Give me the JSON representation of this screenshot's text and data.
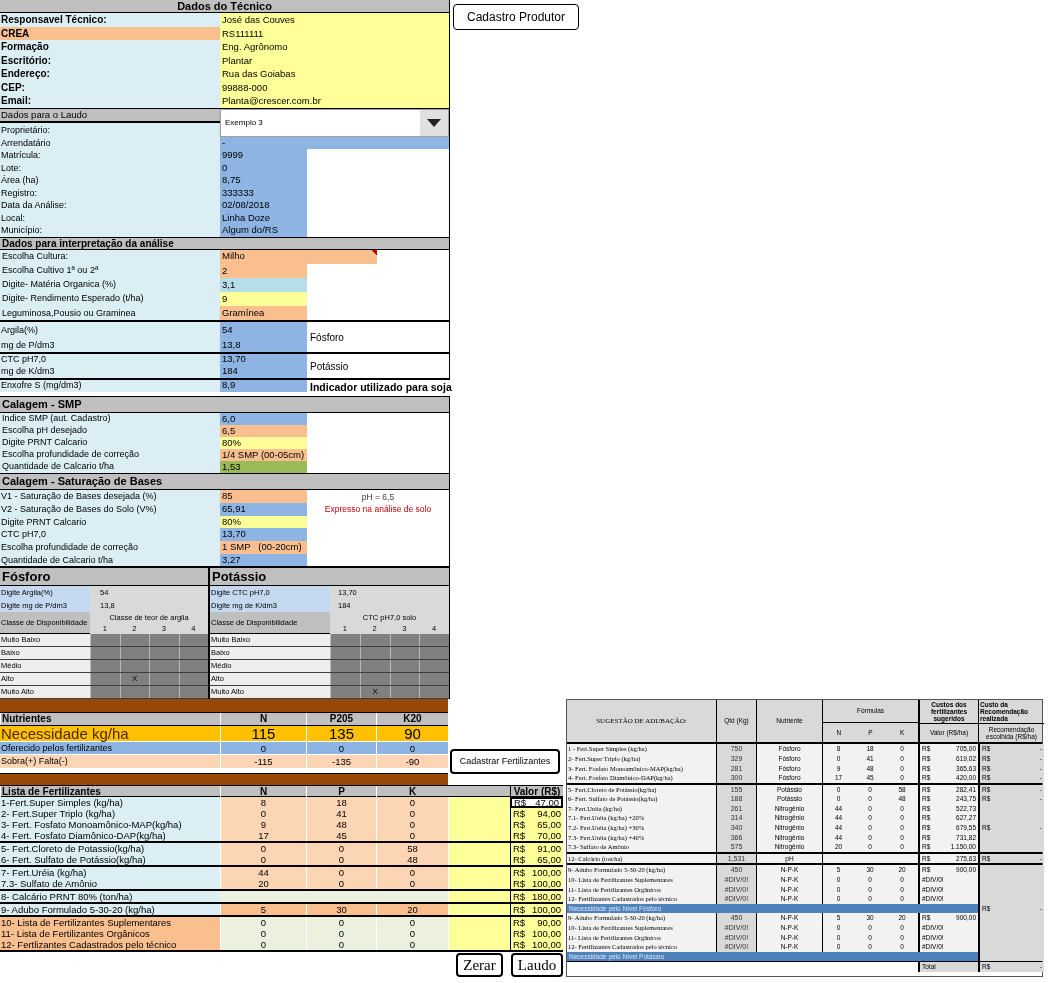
{
  "top_button": "Cadastro Produtor",
  "technician": {
    "title": "Dados do Técnico",
    "rows": [
      {
        "label": "Responsavel Técnico:",
        "value": "José das Couves",
        "highlight": false
      },
      {
        "label": "CREA",
        "value": "RS111111",
        "highlight": true
      },
      {
        "label": "Formação",
        "value": "Eng. Agrônomo",
        "highlight": false
      },
      {
        "label": "Escritório:",
        "value": "Plantar",
        "highlight": false
      },
      {
        "label": "Endereço:",
        "value": "Rua das Goiabas",
        "highlight": false
      },
      {
        "label": "CEP:",
        "value": "99888-000",
        "highlight": false
      },
      {
        "label": "Email:",
        "value": "Planta@crescer.com.br",
        "highlight": false
      }
    ]
  },
  "laudo": {
    "title": "Dados para o Laudo",
    "owner_label": "Proprietário:",
    "dropdown": {
      "value": "Exemplo 3"
    },
    "rows": [
      {
        "label": "Arrendatário",
        "value": "-",
        "wide": true
      },
      {
        "label": "Matrícula:",
        "value": "9999",
        "wide": false
      },
      {
        "label": "Lote:",
        "value": "0",
        "wide": false
      },
      {
        "label": "Área (ha)",
        "value": "8,75",
        "wide": false
      },
      {
        "label": "Registro:",
        "value": "333333",
        "wide": false
      },
      {
        "label": "Data da Análise:",
        "value": "02/08/2018",
        "wide": false
      },
      {
        "label": "Local:",
        "value": "Linha Doze",
        "wide": false
      },
      {
        "label": "Município:",
        "value": "Algum do/RS",
        "wide": false
      }
    ]
  },
  "interpretation": {
    "title": "Dados para interpretação da análise",
    "rows": [
      {
        "label": "Escolha Cultura:",
        "value": "Milho",
        "color": "#fabf8f",
        "wide": true,
        "comment": true
      },
      {
        "label": "Escolha Cultivo 1ª ou 2ª",
        "value": "2",
        "color": "#fabf8f",
        "wide": false,
        "comment": false
      },
      {
        "label": "Digite- Matéria Organica (%)",
        "value": "3,1",
        "color": "#b7dee8",
        "wide": false,
        "comment": false
      },
      {
        "label": "Digite- Rendimento Esperado (t/ha)",
        "value": "9",
        "color": "#ffff99",
        "wide": false,
        "comment": false
      },
      {
        "label": "Leguminosa,Pousio ou Graminea",
        "value": "Gramínea",
        "color": "#fabf8f",
        "wide": false,
        "comment": false
      }
    ],
    "blocks": [
      {
        "side": "Fósforo",
        "bold": false,
        "rows": [
          {
            "label": "Argila(%)",
            "value": "54",
            "color": "#8db4e2"
          },
          {
            "label": "mg de P/dm3",
            "value": "13,8",
            "color": "#8db4e2"
          }
        ]
      },
      {
        "side": "Potássio",
        "bold": false,
        "rows": [
          {
            "label": "CTC pH7,0",
            "value": "13,70",
            "color": "#8db4e2"
          },
          {
            "label": "mg de K/dm3",
            "value": "184",
            "color": "#8db4e2"
          }
        ]
      },
      {
        "side": "Indicador utilizado para soja",
        "bold": true,
        "rows": [
          {
            "label": "Enxofre S (mg/dm3)",
            "value": "8,9",
            "color": "#8db4e2"
          }
        ]
      }
    ]
  },
  "calagem_smp": {
    "title": "Calagem - SMP",
    "rows": [
      {
        "label": "Indice SMP (aut. Cadastro)",
        "value": "6,0",
        "color": "#8db4e2"
      },
      {
        "label": "Escolha pH desejado",
        "value": "6,5",
        "color": "#fabf8f"
      },
      {
        "label": "Digite PRNT  Calcario",
        "value": "80%",
        "color": "#ffff99"
      },
      {
        "label": "Escolha profundidade de correção",
        "value": "1/4 SMP (00-05cm)",
        "color": "#fabf8f"
      },
      {
        "label": "Quantidade de Calcario t/ha",
        "value": "1,53",
        "color": "#9bbb59"
      }
    ]
  },
  "calagem_saturacao": {
    "title": "Calagem - Saturação de Bases",
    "rows": [
      {
        "label": "V1 - Saturação de Bases desejada (%)",
        "value": "85",
        "color": "#fabf8f",
        "note": {
          "text": "pH = 6,5",
          "kind": "remark"
        }
      },
      {
        "label": "V2 - Saturação de Bases do Solo (V%)",
        "value": "65,91",
        "color": "#8db4e2",
        "note": {
          "text": "Expresso na análise de solo",
          "kind": "warning"
        }
      },
      {
        "label": "Digite PRNT Calcario",
        "value": "80%",
        "color": "#ffff99"
      },
      {
        "label": "CTC pH7,0",
        "value": "13,70",
        "color": "#8db4e2"
      },
      {
        "label": "Escolha profundidade de correção",
        "value": "1 SMP   (00-20cm)",
        "color": "#fabf8f"
      },
      {
        "label": "Quantidade de Calcario t/ha",
        "value": "3,27",
        "color": "#8db4e2"
      }
    ]
  },
  "availability": [
    {
      "title": "Fósforo",
      "inputs": [
        {
          "label": "Digite Argila(%)",
          "value": "54"
        },
        {
          "label": "Digite mg de P/dm3",
          "value": "13,8"
        }
      ],
      "class_label": "Classe de Disponibilidade",
      "columns_title": "Classe de teor de argila",
      "columns": [
        "1",
        "2",
        "3",
        "4"
      ],
      "mark_text": "X",
      "rows": [
        {
          "label": "Muito Baixo",
          "cells": [
            {
              "marked": false
            },
            {
              "marked": false
            },
            {
              "marked": false
            },
            {
              "marked": false
            }
          ]
        },
        {
          "label": "Baixo",
          "cells": [
            {
              "marked": false
            },
            {
              "marked": false
            },
            {
              "marked": false
            },
            {
              "marked": false
            }
          ]
        },
        {
          "label": "Médio",
          "cells": [
            {
              "marked": false
            },
            {
              "marked": false
            },
            {
              "marked": false
            },
            {
              "marked": false
            }
          ]
        },
        {
          "label": "Alto",
          "cells": [
            {
              "marked": false
            },
            {
              "marked": true
            },
            {
              "marked": false
            },
            {
              "marked": false
            }
          ]
        },
        {
          "label": "Muito Alto",
          "cells": [
            {
              "marked": false
            },
            {
              "marked": false
            },
            {
              "marked": false
            },
            {
              "marked": false
            }
          ]
        }
      ]
    },
    {
      "title": "Potássio",
      "inputs": [
        {
          "label": "Digite CTC pH7,0",
          "value": "13,70"
        },
        {
          "label": "Digite mg de K/dm3",
          "value": "184"
        }
      ],
      "class_label": "Classe de Disponibilidade",
      "columns_title": "CTC pH7,0 solo",
      "columns": [
        "1",
        "2",
        "3",
        "4"
      ],
      "mark_text": "X",
      "rows": [
        {
          "label": "Muito Baixo",
          "cells": [
            {
              "marked": false
            },
            {
              "marked": false
            },
            {
              "marked": false
            },
            {
              "marked": false
            }
          ]
        },
        {
          "label": "Baixo",
          "cells": [
            {
              "marked": false
            },
            {
              "marked": false
            },
            {
              "marked": false
            },
            {
              "marked": false
            }
          ]
        },
        {
          "label": "Médio",
          "cells": [
            {
              "marked": false
            },
            {
              "marked": false
            },
            {
              "marked": false
            },
            {
              "marked": false
            }
          ]
        },
        {
          "label": "Alto",
          "cells": [
            {
              "marked": false
            },
            {
              "marked": false
            },
            {
              "marked": false
            },
            {
              "marked": false
            }
          ]
        },
        {
          "label": "Muito Alto",
          "cells": [
            {
              "marked": false
            },
            {
              "marked": true
            },
            {
              "marked": false
            },
            {
              "marked": false
            }
          ]
        }
      ]
    }
  ],
  "nutrients": {
    "columns": [
      "Nutrientes",
      "N",
      "P205",
      "K20"
    ],
    "rows": [
      {
        "kind": "need",
        "label": "Necessidade kg/ha",
        "values": [
          "115",
          "135",
          "90"
        ]
      },
      {
        "kind": "offered",
        "label": "Oferecido pelos fertilizantes",
        "values": [
          "0",
          "0",
          "0"
        ]
      },
      {
        "kind": "balance",
        "label": "Sobra(+) Falta(-)",
        "values": [
          "-115",
          "-135",
          "-90"
        ]
      }
    ]
  },
  "register_button": "Cadastrar Fertilizantes",
  "fertilizers": {
    "columns": [
      "Lista de Fertilizantes",
      "N",
      "P",
      "K",
      "Valor (R$)"
    ],
    "groups": [
      {
        "kind": "mineral",
        "rows": [
          {
            "name": "1-Fert.Super Simples (kg/ha)",
            "values": [
              "8",
              "18",
              "0"
            ],
            "currency": "R$",
            "price": "47,00",
            "selected": true
          },
          {
            "name": "2- Fert.Super Triplo (kg/ha)",
            "values": [
              "0",
              "41",
              "0"
            ],
            "currency": "R$",
            "price": "94,00",
            "selected": false
          },
          {
            "name": "3- Fert. Fosfato Monoamônico-MAP(kg/ha)",
            "values": [
              "9",
              "48",
              "0"
            ],
            "currency": "R$",
            "price": "65,00",
            "selected": false
          },
          {
            "name": "4- Fert. Fosfato Diamônico-DAP(kg/ha)",
            "values": [
              "17",
              "45",
              "0"
            ],
            "currency": "R$",
            "price": "70,00",
            "selected": false
          }
        ]
      },
      {
        "kind": "mineral",
        "rows": [
          {
            "name": "5- Fert.Cloreto de Potassio(kg/ha)",
            "values": [
              "0",
              "0",
              "58"
            ],
            "currency": "R$",
            "price": "91,00",
            "selected": false
          },
          {
            "name": "6- Fert. Sulfato de Potássio(kg/ha)",
            "values": [
              "0",
              "0",
              "48"
            ],
            "currency": "R$",
            "price": "65,00",
            "selected": false
          }
        ]
      },
      {
        "kind": "mineral",
        "rows": [
          {
            "name": "7- Fert.Uréia (kg/ha)",
            "values": [
              "44",
              "0",
              "0"
            ],
            "currency": "R$",
            "price": "100,00",
            "selected": false
          },
          {
            "name": "7.3- Sulfato de Amônio",
            "values": [
              "20",
              "0",
              "0"
            ],
            "currency": "R$",
            "price": "100,00",
            "selected": false
          }
        ]
      },
      {
        "kind": "lime",
        "rows": [
          {
            "name": "8- Calcário PRNT 80% (ton/ha)",
            "currency": "R$",
            "price": "180,00",
            "selected": false
          }
        ]
      },
      {
        "kind": "formula",
        "rows": [
          {
            "name": "9- Adubo Formulado  5-30-20 (kg/ha)",
            "values": [
              "5",
              "30",
              "20"
            ],
            "currency": "R$",
            "price": "100,00",
            "selected": false
          }
        ]
      },
      {
        "kind": "extra",
        "rows": [
          {
            "name": "10- Lista de Fertilizantes Suplementares",
            "values": [
              "0",
              "0",
              "0"
            ],
            "currency": "R$",
            "price": "90,00",
            "selected": false
          },
          {
            "name": "11- Lista de Fertilizantes Orgânicos",
            "values": [
              "0",
              "0",
              "0"
            ],
            "currency": "R$",
            "price": "100,00",
            "selected": false
          },
          {
            "name": "12- Fertlizantes Cadastrados pelo técnico",
            "values": [
              "0",
              "0",
              "0"
            ],
            "currency": "R$",
            "price": "100,00",
            "selected": false
          }
        ]
      }
    ]
  },
  "action_buttons": [
    "Zerar",
    "Laudo"
  ],
  "suggestion": {
    "columns": {
      "name": "SUGESTÃO DE ADUBAÇÃO:",
      "qty": "Qtd (Kg)",
      "nutrient": "Nutriente",
      "formulas": "Fórmulas",
      "n": "N",
      "p": "P",
      "k": "K",
      "costs": "Custos dos fertilizantes sugeridos",
      "costs_sub": "Valor (R$/ha)",
      "rec": "Custo da Recomendação realizada",
      "rec_sub": "Recomendação escolhida (R$/ha)"
    },
    "groups": [
      {
        "rows": [
          {
            "kind": "item",
            "name": "1 - Fert.Super Simples (kg/ha)",
            "qty": "750",
            "nutrient": "Fósforo",
            "n": "8",
            "p": "18",
            "k": "0",
            "currency": "R$",
            "cost": "705,00",
            "rec_currency": "R$",
            "rec": "-"
          },
          {
            "kind": "item",
            "name": "2- Fert.Super Triplo (kg/ha)",
            "qty": "329",
            "nutrient": "Fósforo",
            "n": "0",
            "p": "41",
            "k": "0",
            "currency": "R$",
            "cost": "619,02",
            "rec_currency": "R$",
            "rec": "-"
          },
          {
            "kind": "item",
            "name": "3- Fert. Fosfato Monoamônico-MAP(kg/ha)",
            "qty": "281",
            "nutrient": "Fósforo",
            "n": "9",
            "p": "48",
            "k": "0",
            "currency": "R$",
            "cost": "365,63",
            "rec_currency": "R$",
            "rec": "-"
          },
          {
            "kind": "item",
            "name": "4- Fert. Fosfato Diamônico-DAP(kg/ha)",
            "qty": "300",
            "nutrient": "Fósforo",
            "n": "17",
            "p": "45",
            "k": "0",
            "currency": "R$",
            "cost": "420,00",
            "rec_currency": "R$",
            "rec": "-"
          }
        ]
      },
      {
        "rows": [
          {
            "kind": "item",
            "name": "5- Fert.Cloreto de Potássio(kg/ha)",
            "qty": "155",
            "nutrient": "Potássio",
            "n": "0",
            "p": "0",
            "k": "58",
            "currency": "R$",
            "cost": "282,41",
            "rec_currency": "R$",
            "rec": "-"
          },
          {
            "kind": "item",
            "name": "6- Fert. Sulfato de Potássio(kg/ha)",
            "qty": "188",
            "nutrient": "Potássio",
            "n": "0",
            "p": "0",
            "k": "48",
            "currency": "R$",
            "cost": "243,75",
            "rec_currency": "R$",
            "rec": "-"
          },
          {
            "kind": "item",
            "name": "7- Fert.Uréia (kg/ha)",
            "qty": "261",
            "nutrient": "Nitrogênio",
            "n": "44",
            "p": "0",
            "k": "0",
            "currency": "R$",
            "cost": "522,73"
          },
          {
            "kind": "item",
            "name": "7.1- Fert.Uréia (kg/ha) +20%",
            "qty": "314",
            "nutrient": "Nitrogênio",
            "n": "44",
            "p": "0",
            "k": "0",
            "currency": "R$",
            "cost": "627,27"
          },
          {
            "kind": "item",
            "name": "7.2- Fert.Uréia (kg/ha) +30%",
            "qty": "340",
            "nutrient": "Nitrogênio",
            "n": "44",
            "p": "0",
            "k": "0",
            "currency": "R$",
            "cost": "679,55",
            "rec_currency": "R$",
            "rec": "-"
          },
          {
            "kind": "item",
            "name": "7.3- Fert.Uréia (kg/ha) +40%",
            "qty": "366",
            "nutrient": "Nitrogênio",
            "n": "44",
            "p": "0",
            "k": "0",
            "currency": "R$",
            "cost": "731,82"
          },
          {
            "kind": "item",
            "name": "7.3- Sulfato de Amônio",
            "qty": "575",
            "nutrient": "Nitrogênio",
            "n": "20",
            "p": "0",
            "k": "0",
            "currency": "R$",
            "cost": "1.150,00"
          }
        ]
      },
      {
        "rows": [
          {
            "kind": "item",
            "name": "12- Calcário (ton/ha)",
            "qty": "1,531",
            "nutrient": "pH",
            "currency": "R$",
            "cost": "275,63",
            "rec_currency": "R$",
            "rec": "-"
          }
        ]
      },
      {
        "rows": [
          {
            "kind": "item",
            "name": "9- Adubo Formulado  5-30-20 (kg/ha)",
            "qty": "450",
            "nutrient": "N-P-K",
            "n": "5",
            "p": "30",
            "k": "20",
            "currency": "R$",
            "cost": "900,00"
          },
          {
            "kind": "item",
            "name": "10- Lista de Fertilizantes Suplementares",
            "qty": "#DIV/0!",
            "nutrient": "N-P-K",
            "n": "0",
            "p": "0",
            "k": "0",
            "cost": "#DIV/0!"
          },
          {
            "kind": "item",
            "name": "11- Lista de Fertilizantes Orgânicos",
            "qty": "#DIV/0!",
            "nutrient": "N-P-K",
            "n": "0",
            "p": "0",
            "k": "0",
            "cost": "#DIV/0!"
          },
          {
            "kind": "item",
            "name": "12- Fertilizantes Cadastrados pelo técnico",
            "qty": "#DIV/0!",
            "nutrient": "N-P-K",
            "n": "0",
            "p": "0",
            "k": "0",
            "cost": "#DIV/0!"
          },
          {
            "kind": "band",
            "label": "Necessidade pelo Nível Fósforo",
            "rec_currency": "R$",
            "rec": "-"
          },
          {
            "kind": "item",
            "name": "9- Adubo Formulado  5-30-20 (kg/ha)",
            "qty": "450",
            "nutrient": "N-P-K",
            "n": "5",
            "p": "30",
            "k": "20",
            "currency": "R$",
            "cost": "900,00"
          },
          {
            "kind": "item",
            "name": "10- Lista de Fertilizantes Suplementares",
            "qty": "#DIV/0!",
            "nutrient": "N-P-K",
            "n": "0",
            "p": "0",
            "k": "0",
            "cost": "#DIV/0!"
          },
          {
            "kind": "item",
            "name": "11- Lista de Fertilizantes Orgânicos",
            "qty": "#DIV/0!",
            "nutrient": "N-P-K",
            "n": "0",
            "p": "0",
            "k": "0",
            "cost": "#DIV/0!"
          },
          {
            "kind": "item",
            "name": "12- Fertilizantes Cadastrados pelo técnico",
            "qty": "#DIV/0!",
            "nutrient": "N-P-K",
            "n": "0",
            "p": "0",
            "k": "0",
            "cost": "#DIV/0!"
          },
          {
            "kind": "band",
            "label": "Necessidade pelo Nível Potássio"
          }
        ]
      }
    ],
    "footer": {
      "label": "Total",
      "currency": "R$",
      "value": "-"
    }
  }
}
